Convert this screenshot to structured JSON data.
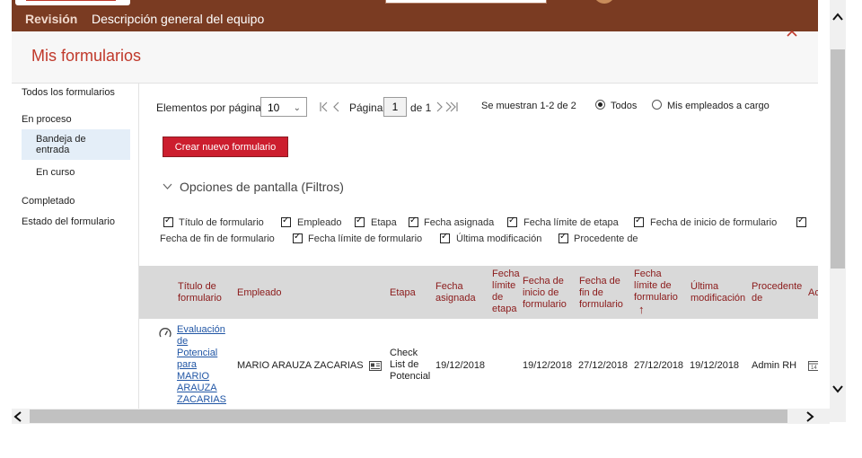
{
  "topnav": {
    "tab_revision": "Revisión",
    "tab_team_overview": "Descripción general del equipo"
  },
  "header": {
    "title": "Mis formularios"
  },
  "sidebar": {
    "all_forms": "Todos los formularios",
    "in_progress": "En proceso",
    "inbox": "Bandeja de entrada",
    "in_route": "En curso",
    "completed": "Completado",
    "form_status": "Estado del formulario"
  },
  "toolbar": {
    "items_per_page_label": "Elementos por página",
    "items_per_page_value": "10",
    "page_label": "Página",
    "page_value": "1",
    "page_of": "de 1",
    "showing": "Se muestran 1-2 de 2",
    "radio_all": "Todos",
    "radio_my_reports": "Mis empleados a cargo",
    "create_button": "Crear nuevo formulario",
    "filters_toggle": "Opciones de pantalla (Filtros)"
  },
  "filters": [
    "Título de formulario",
    "Empleado",
    "Etapa",
    "Fecha asignada",
    "Fecha límite de etapa",
    "Fecha de inicio de formulario",
    "Fecha de fin de formulario",
    "Fecha límite de formulario",
    "Última modificación",
    "Procedente de"
  ],
  "table": {
    "headers": {
      "title": "Título de formulario",
      "employee": "Empleado",
      "stage": "Etapa",
      "assigned": "Fecha asignada",
      "stage_due": "Fecha límite de etapa",
      "start": "Fecha de inicio de formulario",
      "end": "Fecha de fin de formulario",
      "form_due": "Fecha límite de formulario",
      "last_mod": "Última modificación",
      "from": "Procedente de",
      "actions": "Acci"
    },
    "sort_indicator": "↑",
    "rows": [
      {
        "title": "Evaluación de Potencial para MARIO ARAUZA ZACARIAS",
        "employee": "MARIO ARAUZA ZACARIAS",
        "stage": "Check List de Potencial",
        "assigned": "19/12/2018",
        "stage_due": "",
        "start": "19/12/2018",
        "end": "27/12/2018",
        "form_due": "27/12/2018",
        "last_mod": "19/12/2018",
        "from": "Admin RH"
      }
    ]
  }
}
